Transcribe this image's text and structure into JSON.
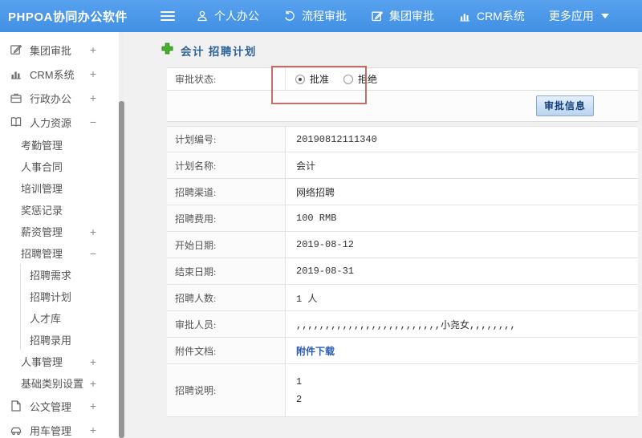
{
  "colors": {
    "header_blue": "#4290e3",
    "accent_green": "#49b02e",
    "title_blue": "#2f6398",
    "link_blue": "#2a5db0",
    "annotation_red": "#bb5650"
  },
  "header": {
    "logo": "PHPOA协同办公软件",
    "nav": [
      {
        "label": "个人办公",
        "icon": "person-icon"
      },
      {
        "label": "流程审批",
        "icon": "flow-icon"
      },
      {
        "label": "集团审批",
        "icon": "edit-icon"
      },
      {
        "label": "CRM系统",
        "icon": "barchart-icon"
      },
      {
        "label": "更多应用",
        "icon": "caret-down-icon"
      }
    ]
  },
  "sidebar": {
    "items": [
      {
        "label": "集团审批",
        "icon": "edit",
        "level": 0,
        "expand": "+"
      },
      {
        "label": "CRM系统",
        "icon": "chart",
        "level": 0,
        "expand": "+"
      },
      {
        "label": "行政办公",
        "icon": "briefcase",
        "level": 0,
        "expand": "+"
      },
      {
        "label": "人力资源",
        "icon": "book",
        "level": 0,
        "expand": "−"
      },
      {
        "label": "考勤管理",
        "level": 1
      },
      {
        "label": "人事合同",
        "level": 1
      },
      {
        "label": "培训管理",
        "level": 1
      },
      {
        "label": "奖惩记录",
        "level": 1
      },
      {
        "label": "薪资管理",
        "level": 1,
        "expand": "+"
      },
      {
        "label": "招聘管理",
        "level": 1,
        "expand": "−"
      },
      {
        "label": "招聘需求",
        "level": 2
      },
      {
        "label": "招聘计划",
        "level": 2
      },
      {
        "label": "人才库",
        "level": 2
      },
      {
        "label": "招聘录用",
        "level": 2
      },
      {
        "label": "人事管理",
        "level": 1,
        "expand": "+"
      },
      {
        "label": "基础类别设置",
        "level": 1,
        "expand": "+"
      },
      {
        "label": "公文管理",
        "icon": "doc",
        "level": 0,
        "expand": "+"
      },
      {
        "label": "用车管理",
        "icon": "car",
        "level": 0,
        "expand": "+"
      }
    ]
  },
  "main": {
    "page_title": "会计 招聘计划",
    "approval": {
      "status_label": "审批状态:",
      "options": [
        {
          "label": "批准",
          "checked": true
        },
        {
          "label": "拒绝",
          "checked": false
        }
      ],
      "info_button": "审批信息"
    },
    "form": {
      "rows": [
        {
          "label": "计划编号:",
          "value": "20190812111340"
        },
        {
          "label": "计划名称:",
          "value": "会计"
        },
        {
          "label": "招聘渠道:",
          "value": "网络招聘"
        },
        {
          "label": "招聘费用:",
          "value": "100 RMB"
        },
        {
          "label": "开始日期:",
          "value": "2019-08-12"
        },
        {
          "label": "结束日期:",
          "value": "2019-08-31"
        },
        {
          "label": "招聘人数:",
          "value": "1 人"
        },
        {
          "label": "审批人员:",
          "value": ",,,,,,,,,,,,,,,,,,,,,,,,,小尧女,,,,,,,,"
        },
        {
          "label": "附件文档:",
          "value": "附件下载",
          "type": "link"
        },
        {
          "label": "招聘说明:",
          "value": "1\n2",
          "type": "multiline"
        }
      ]
    }
  }
}
